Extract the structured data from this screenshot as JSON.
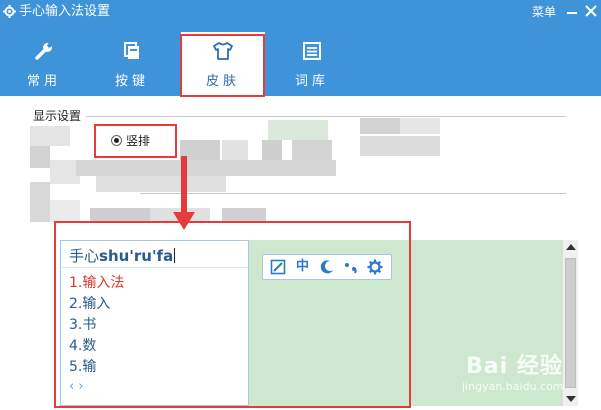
{
  "window": {
    "title": "手心输入法设置",
    "menu_label": "菜单",
    "accent_color": "#3f93d8"
  },
  "tabs": [
    {
      "label": "常用",
      "icon": "wrench-icon",
      "active": false
    },
    {
      "label": "按键",
      "icon": "keyboard-icon",
      "active": false
    },
    {
      "label": "皮肤",
      "icon": "shirt-icon",
      "active": true
    },
    {
      "label": "词库",
      "icon": "list-icon",
      "active": false
    }
  ],
  "display": {
    "group_label": "显示设置",
    "layout_option": {
      "label": "竖排",
      "checked": true
    }
  },
  "preview": {
    "input_prefix": "手心",
    "input_pinyin": "shu'ru'fa",
    "candidates": [
      "1.输入法",
      "2.输入",
      "3.书",
      "4.数",
      "5.输"
    ],
    "pager": "‹ ›",
    "toolbar": {
      "mode_label": "中",
      "icons": [
        "edit-icon",
        "moon-icon",
        "punctuation-icon",
        "gear-icon"
      ]
    }
  },
  "watermark": {
    "main": "Bai 经验",
    "sub": "jingyan.baidu.com"
  },
  "colors": {
    "highlight": "#e63b3b",
    "preview_bg": "#cde8cf",
    "candidate_first": "#d23a2a"
  }
}
